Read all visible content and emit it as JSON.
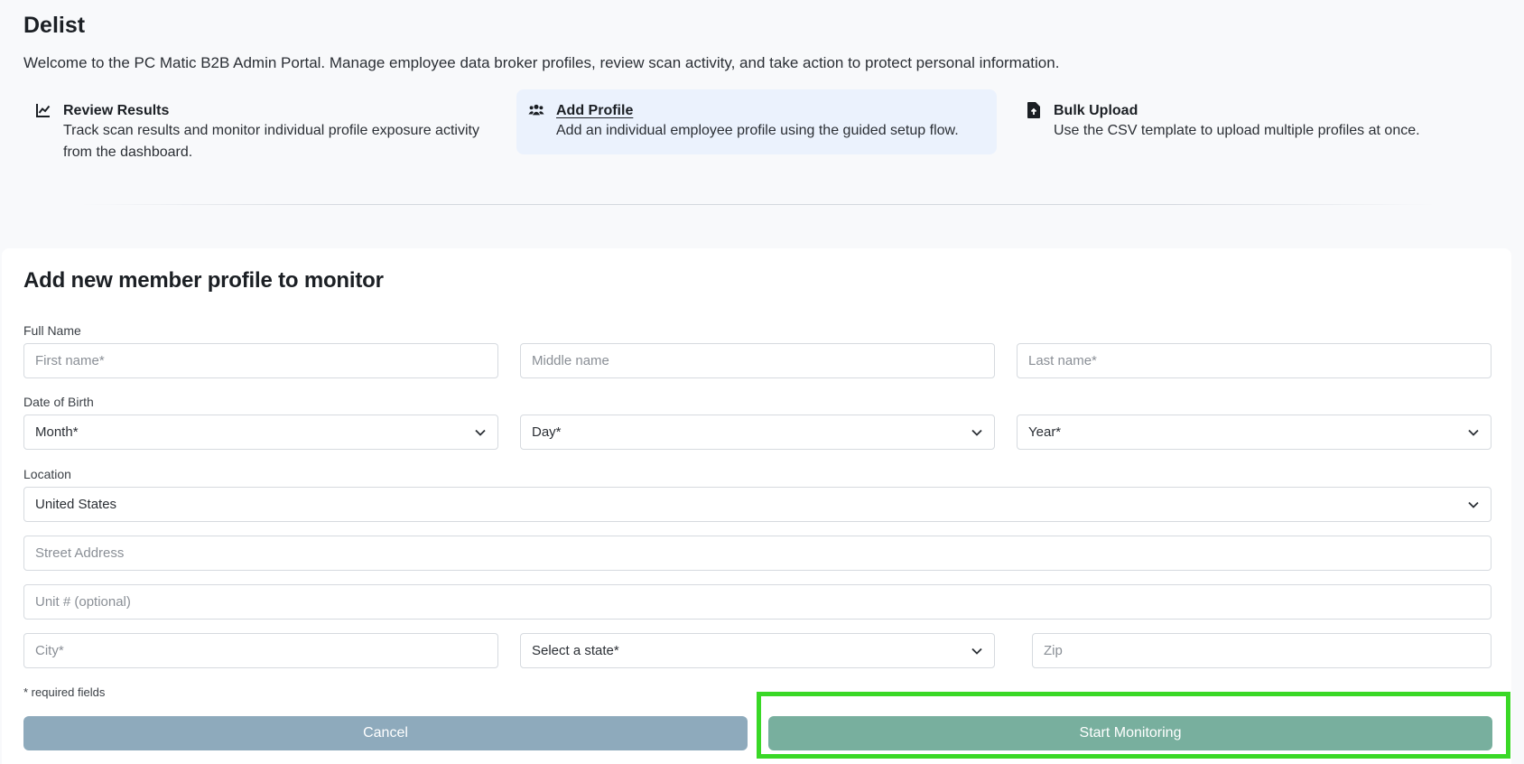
{
  "header": {
    "title": "Delist",
    "welcome": "Welcome to the PC Matic B2B Admin Portal. Manage employee data broker profiles, review scan activity, and take action to protect personal information."
  },
  "quick_links": [
    {
      "title": "Review Results",
      "desc": "Track scan results and monitor individual profile exposure activity from the dashboard.",
      "icon": "chart-line-icon"
    },
    {
      "title": "Add Profile",
      "desc": "Add an individual employee profile using the guided setup flow.",
      "icon": "users-icon"
    },
    {
      "title": "Bulk Upload",
      "desc": "Use the CSV template to upload multiple profiles at once.",
      "icon": "file-upload-icon"
    }
  ],
  "form": {
    "title": "Add new member profile to monitor",
    "full_name_label": "Full Name",
    "first_name_placeholder": "First name*",
    "middle_name_placeholder": "Middle name",
    "last_name_placeholder": "Last name*",
    "dob_label": "Date of Birth",
    "month": "Month*",
    "day": "Day*",
    "year": "Year*",
    "location_label": "Location",
    "country": "United States",
    "street_placeholder": "Street Address",
    "unit_placeholder": "Unit # (optional)",
    "city_placeholder": "City*",
    "state": "Select a state*",
    "zip_placeholder": "Zip",
    "required_note": "* required fields",
    "cancel_label": "Cancel",
    "start_label": "Start Monitoring"
  },
  "colors": {
    "cancel": "#8eaabc",
    "start": "#78af9e",
    "active_link_bg": "#ebf2fd",
    "highlight": "#39d826"
  }
}
